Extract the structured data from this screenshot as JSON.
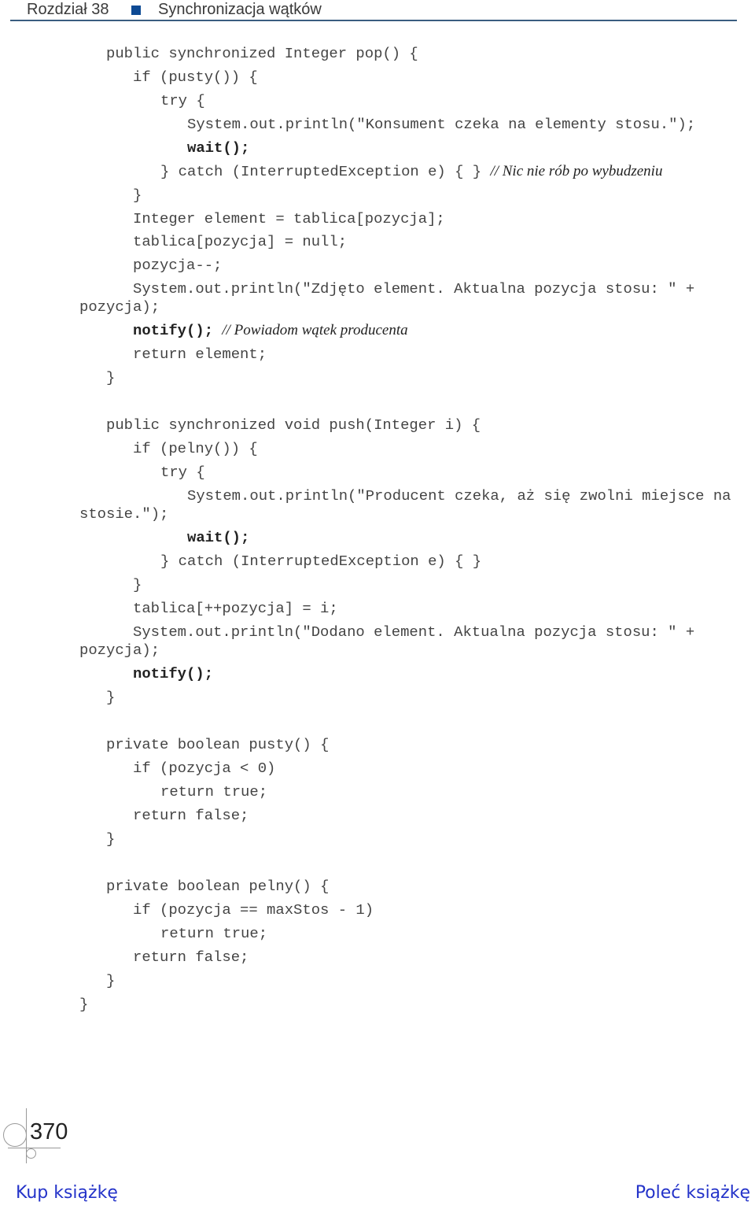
{
  "header": {
    "chapter": "Rozdział 38",
    "title": "Synchronizacja wątków",
    "accent_color": "#0d4a94"
  },
  "code": {
    "pop_signature": "public synchronized Integer pop() {",
    "pop_if": "if (pusty()) {",
    "pop_try": "try {",
    "pop_print_wait": "System.out.println(\"Konsument czeka na elementy stosu.\");",
    "pop_wait": "wait();",
    "pop_catch": "} catch (InterruptedException e) { }",
    "pop_catch_comment": "// Nic nie rób po wybudzeniu",
    "pop_if_close": "}",
    "pop_element": "Integer element = tablica[pozycja];",
    "pop_null": "tablica[pozycja] = null;",
    "pop_decrement": "pozycja--;",
    "pop_print_removed_1": "System.out.println(\"Zdjęto element. Aktualna pozycja stosu: \" +",
    "pop_print_removed_2": "pozycja);",
    "pop_notify": "notify();",
    "pop_notify_comment": "// Powiadom wątek producenta",
    "pop_return": "return element;",
    "pop_close": "}",
    "push_signature": "public synchronized void push(Integer i) {",
    "push_if": "if (pelny()) {",
    "push_try": "try {",
    "push_print_wait_1": "System.out.println(\"Producent czeka, aż się zwolni miejsce na",
    "push_print_wait_2": "stosie.\");",
    "push_wait": "wait();",
    "push_catch": "} catch (InterruptedException e) { }",
    "push_if_close": "}",
    "push_assign": "tablica[++pozycja] = i;",
    "push_print_added_1": "System.out.println(\"Dodano element. Aktualna pozycja stosu: \" +",
    "push_print_added_2": "pozycja);",
    "push_notify": "notify();",
    "push_close": "}",
    "pusty_signature": "private boolean pusty() {",
    "pusty_if": "if (pozycja < 0)",
    "pusty_return_true": "return true;",
    "pusty_return_false": "return false;",
    "pusty_close": "}",
    "pelny_signature": "private boolean pelny() {",
    "pelny_if": "if (pozycja == maxStos - 1)",
    "pelny_return_true": "return true;",
    "pelny_return_false": "return false;",
    "pelny_close": "}",
    "class_close": "}"
  },
  "page_number": "370",
  "footer": {
    "buy_link": "Kup książkę",
    "recommend_link": "Poleć książkę",
    "link_color": "#2433c9"
  }
}
